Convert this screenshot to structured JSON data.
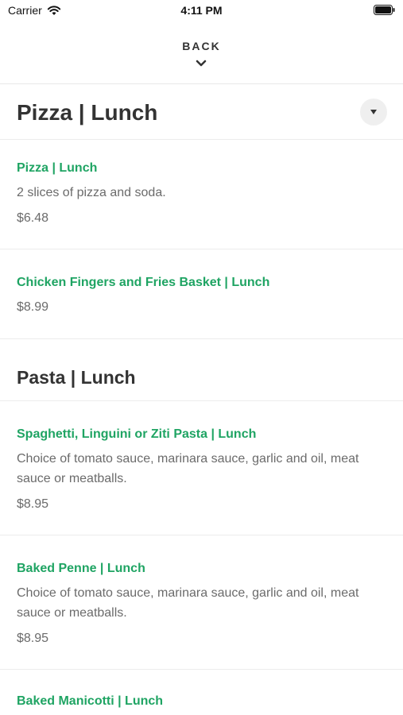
{
  "status_bar": {
    "carrier": "Carrier",
    "time": "4:11 PM"
  },
  "nav": {
    "back_label": "BACK"
  },
  "colors": {
    "item_name": "#1fa463",
    "secondary_text": "#6b6b6b",
    "heading_text": "#333333"
  },
  "sections": [
    {
      "title": "Pizza | Lunch",
      "items": [
        {
          "name": "Pizza | Lunch",
          "description": "2 slices of pizza and soda.",
          "price": "$6.48"
        },
        {
          "name": "Chicken Fingers and Fries Basket | Lunch",
          "price": "$8.99"
        }
      ]
    },
    {
      "title": "Pasta | Lunch",
      "items": [
        {
          "name": "Spaghetti, Linguini or Ziti Pasta | Lunch",
          "description": "Choice of tomato sauce, marinara sauce, garlic and oil, meat sauce or meatballs.",
          "price": "$8.95"
        },
        {
          "name": "Baked Penne | Lunch",
          "description": "Choice of tomato sauce, marinara sauce, garlic and oil, meat sauce or meatballs.",
          "price": "$8.95"
        },
        {
          "name": "Baked Manicotti | Lunch"
        }
      ]
    }
  ]
}
